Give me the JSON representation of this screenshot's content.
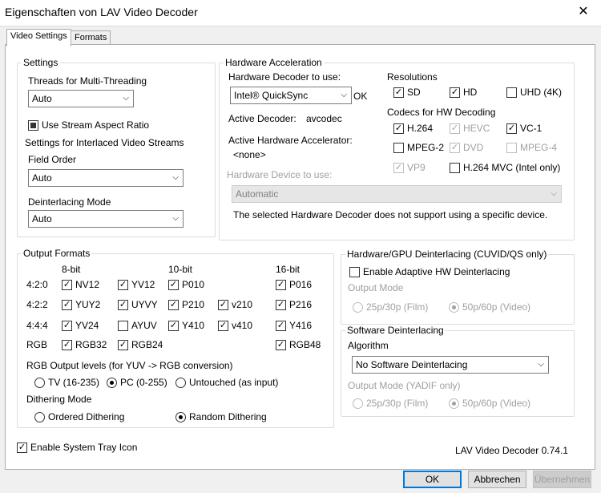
{
  "window": {
    "title": "Eigenschaften von LAV Video Decoder"
  },
  "tabs": [
    {
      "label": "Video Settings",
      "active": true
    },
    {
      "label": "Formats",
      "active": false
    }
  ],
  "settings": {
    "group_label": "Settings",
    "threads_label": "Threads for Multi-Threading",
    "threads_value": "Auto",
    "stream_aspect_label": "Use Stream Aspect Ratio",
    "interlaced_label": "Settings for Interlaced Video Streams",
    "field_order_label": "Field Order",
    "field_order_value": "Auto",
    "deint_mode_label": "Deinterlacing Mode",
    "deint_mode_value": "Auto"
  },
  "hwaccel": {
    "group_label": "Hardware Acceleration",
    "decoder_label": "Hardware Decoder to use:",
    "decoder_value": "Intel® QuickSync",
    "decoder_status": "OK",
    "active_decoder_label": "Active Decoder:",
    "active_decoder_value": "avcodec",
    "active_accel_label": "Active Hardware Accelerator:",
    "active_accel_value": "<none>",
    "device_label": "Hardware Device to use:",
    "device_value": "Automatic",
    "device_note": "The selected Hardware Decoder does not support using a specific device.",
    "resolutions_label": "Resolutions",
    "res_sd": "SD",
    "res_hd": "HD",
    "res_uhd": "UHD (4K)",
    "codecs_label": "Codecs for HW Decoding",
    "codec_h264": "H.264",
    "codec_hevc": "HEVC",
    "codec_vc1": "VC-1",
    "codec_mpeg2": "MPEG-2",
    "codec_dvd": "DVD",
    "codec_mpeg4": "MPEG-4",
    "codec_vp9": "VP9",
    "codec_mvc": "H.264 MVC (Intel only)"
  },
  "output": {
    "group_label": "Output Formats",
    "col_8bit": "8-bit",
    "col_10bit": "10-bit",
    "col_16bit": "16-bit",
    "row_420": "4:2:0",
    "row_422": "4:2:2",
    "row_444": "4:4:4",
    "row_rgb": "RGB",
    "nv12": "NV12",
    "yv12": "YV12",
    "p010": "P010",
    "p016": "P016",
    "yuy2": "YUY2",
    "uyvy": "UYVY",
    "p210": "P210",
    "v210": "v210",
    "p216": "P216",
    "yv24": "YV24",
    "ayuv": "AYUV",
    "y410": "Y410",
    "v410": "v410",
    "y416": "Y416",
    "rgb32": "RGB32",
    "rgb24": "RGB24",
    "rgb48": "RGB48",
    "rgb_levels_label": "RGB Output levels (for YUV -> RGB conversion)",
    "lvl_tv": "TV (16-235)",
    "lvl_pc": "PC (0-255)",
    "lvl_untouched": "Untouched (as input)",
    "dither_label": "Dithering Mode",
    "dither_ordered": "Ordered Dithering",
    "dither_random": "Random Dithering"
  },
  "hwdeint": {
    "group_label": "Hardware/GPU Deinterlacing (CUVID/QS only)",
    "enable_label": "Enable Adaptive HW Deinterlacing",
    "output_mode_label": "Output Mode",
    "film": "25p/30p (Film)",
    "video": "50p/60p (Video)"
  },
  "swdeint": {
    "group_label": "Software Deinterlacing",
    "algorithm_label": "Algorithm",
    "algorithm_value": "No Software Deinterlacing",
    "output_mode_label": "Output Mode (YADIF only)",
    "film": "25p/30p (Film)",
    "video": "50p/60p (Video)"
  },
  "footer": {
    "tray_label": "Enable System Tray Icon",
    "version": "LAV Video Decoder 0.74.1"
  },
  "buttons": {
    "ok": "OK",
    "cancel": "Abbrechen",
    "apply": "Übernehmen"
  },
  "colors": {
    "accent": "#0078d7",
    "dialog_bg": "#f0f0f0",
    "disabled_text": "#a0a0a0"
  }
}
